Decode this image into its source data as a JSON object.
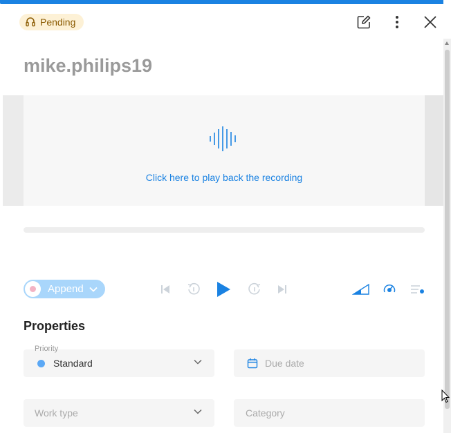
{
  "status_badge": {
    "label": "Pending",
    "color": "#fdf1d6"
  },
  "header": {
    "icons": [
      "edit-icon",
      "more-icon",
      "close-icon"
    ]
  },
  "title": "mike.philips19",
  "player": {
    "play_prompt": "Click here to play back the recording",
    "append_label": "Append",
    "accent_color": "#1a82e2"
  },
  "properties": {
    "title": "Properties",
    "priority": {
      "label": "Priority",
      "value": "Standard",
      "dot_color": "#5ba8f5"
    },
    "due_date": {
      "placeholder": "Due date"
    },
    "work_type": {
      "placeholder": "Work type"
    },
    "category": {
      "placeholder": "Category"
    }
  }
}
